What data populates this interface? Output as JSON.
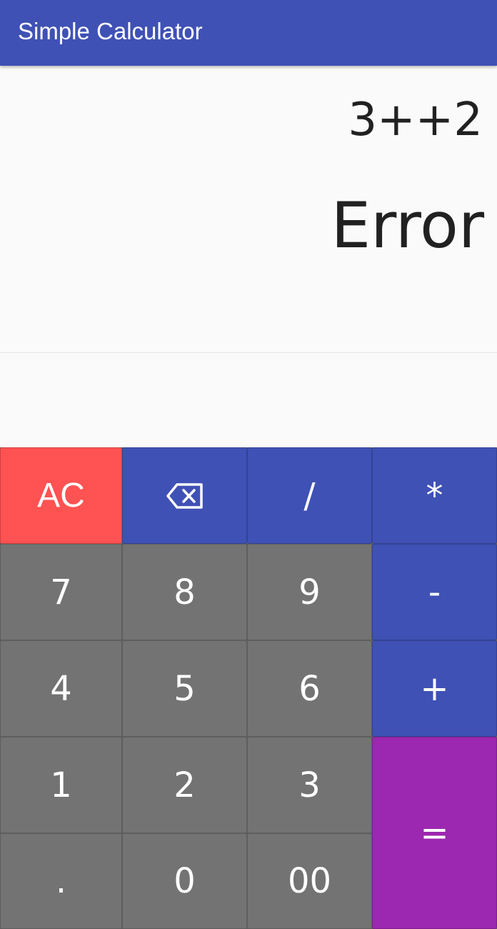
{
  "app_bar": {
    "title": "Simple Calculator"
  },
  "display": {
    "expression": "3++2",
    "result": "Error"
  },
  "keys": {
    "ac": "AC",
    "backspace_icon": "backspace-icon",
    "divide": "/",
    "multiply": "*",
    "seven": "7",
    "eight": "8",
    "nine": "9",
    "minus": "-",
    "four": "4",
    "five": "5",
    "six": "6",
    "plus": "+",
    "one": "1",
    "two": "2",
    "three": "3",
    "equals": "=",
    "dot": ".",
    "zero": "0",
    "double_zero": "00"
  },
  "colors": {
    "primary": "#3f51b5",
    "clear": "#ff5252",
    "equals": "#9c27b0",
    "number_key": "#737373"
  }
}
